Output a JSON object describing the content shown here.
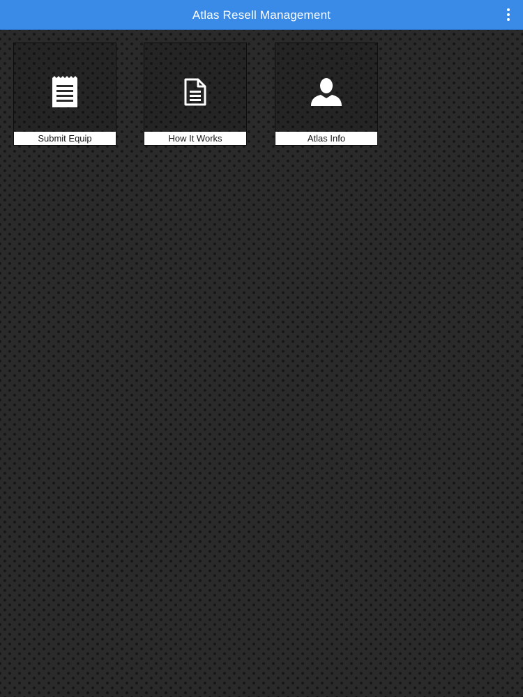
{
  "header": {
    "title": "Atlas Resell Management",
    "menu_icon": "more-vertical-icon",
    "background_color": "#3a8ae8"
  },
  "tiles": [
    {
      "label": "Submit Equip",
      "icon": "notepad-icon"
    },
    {
      "label": "How It Works",
      "icon": "document-icon"
    },
    {
      "label": "Atlas Info",
      "icon": "user-icon"
    }
  ],
  "colors": {
    "accent": "#3a8ae8",
    "background": "#2a2a2a",
    "tile_label_bg": "#ffffff"
  }
}
